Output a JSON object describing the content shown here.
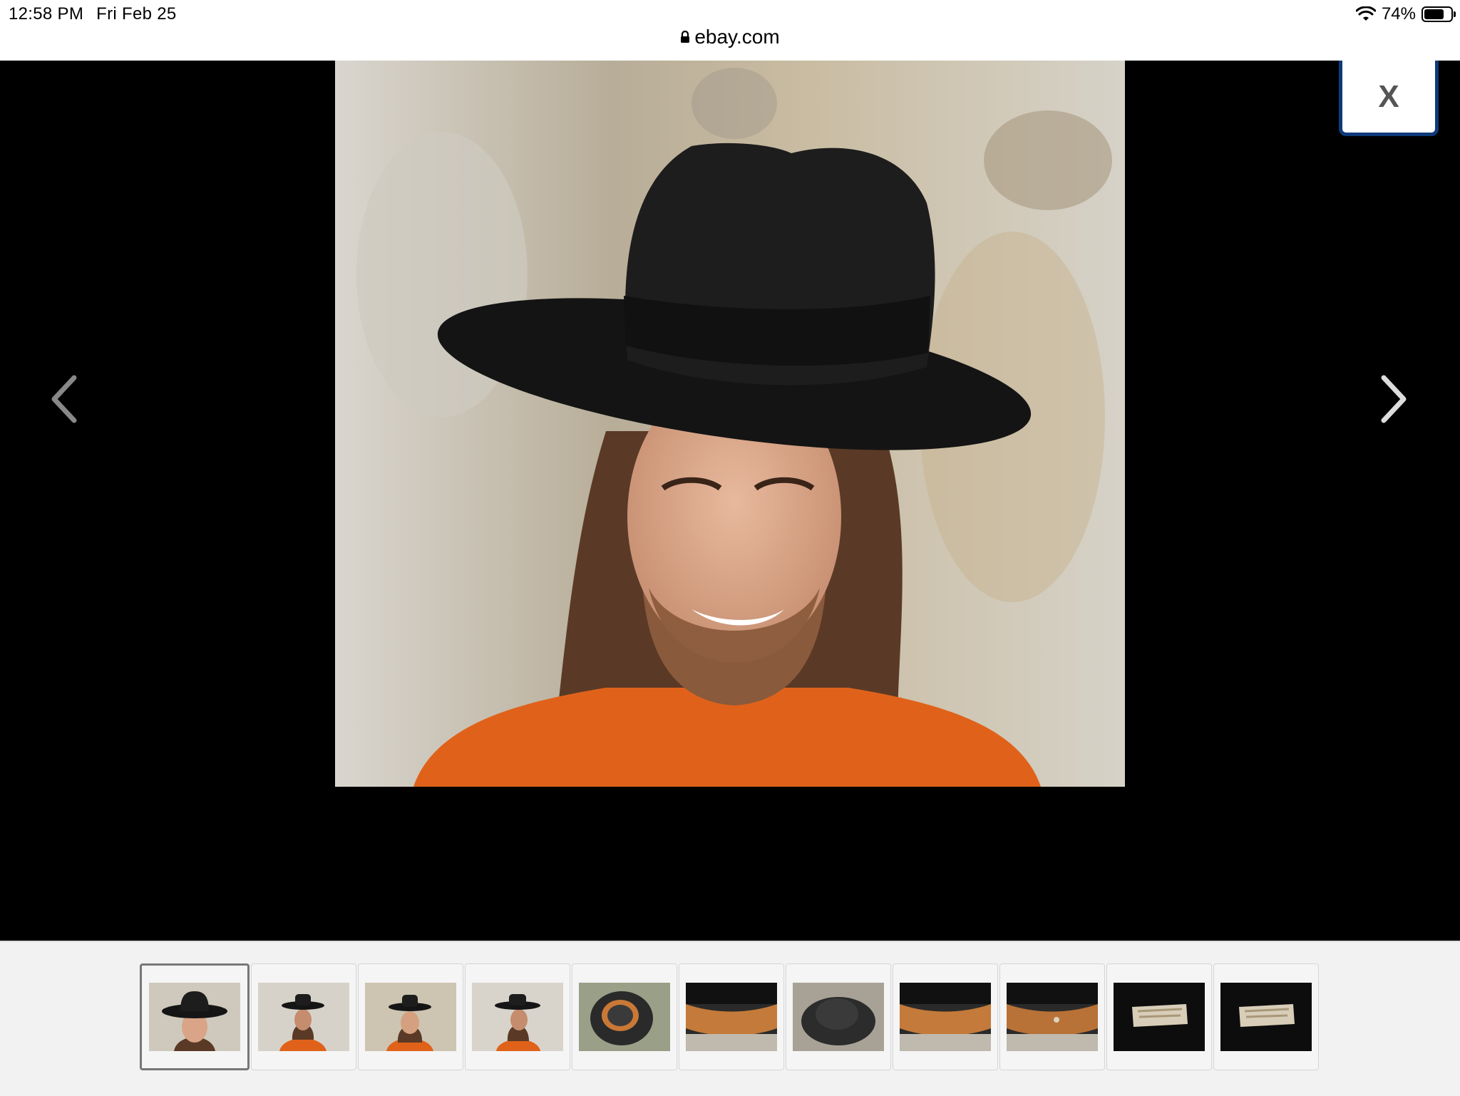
{
  "status": {
    "time": "12:58 PM",
    "date": "Fri Feb 25",
    "battery": "74%",
    "battery_level": 0.74
  },
  "browser": {
    "url": "ebay.com"
  },
  "viewer": {
    "close_label": "X",
    "active_index": 0,
    "thumbnails": [
      {
        "kind": "front-smile"
      },
      {
        "kind": "side-left"
      },
      {
        "kind": "front-wall"
      },
      {
        "kind": "side-right"
      },
      {
        "kind": "brim-inside"
      },
      {
        "kind": "leather-band"
      },
      {
        "kind": "crown-top"
      },
      {
        "kind": "leather-band"
      },
      {
        "kind": "leather-band-marked"
      },
      {
        "kind": "label-black"
      },
      {
        "kind": "label-black"
      }
    ]
  },
  "colors": {
    "close_border": "#0f3a7a",
    "hat": "#1a1a1a",
    "shirt": "#e0621a"
  }
}
